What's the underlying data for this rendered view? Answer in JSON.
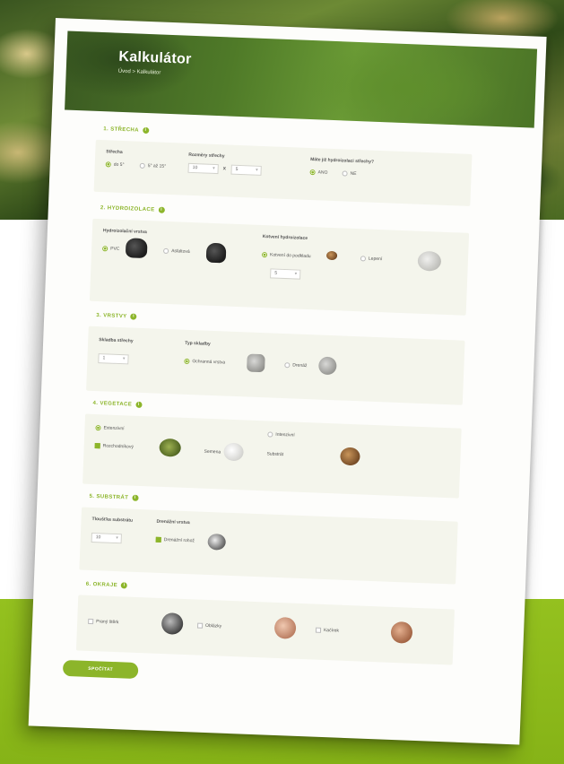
{
  "header": {
    "title": "Kalkulátor",
    "breadcrumb": "Úvod > Kalkulátor"
  },
  "sections": [
    {
      "title": "1. STŘECHA",
      "fields": {
        "roof_type_label": "Střecha",
        "roof_type_options": [
          "do 5°",
          "5° až 15°"
        ],
        "size_label": "Rozměry střechy",
        "size_a": "10",
        "size_b": "5",
        "size_sep": "x",
        "question_label": "Máte již hydroizolaci střechy?",
        "question_options": [
          "ANO",
          "NE"
        ]
      }
    },
    {
      "title": "2. HYDROIZOLACE",
      "fields": {
        "type_label": "Hydroizolační vrstva",
        "type_options": [
          "PVC",
          "Asfaltová"
        ],
        "extra_label": "Kotvení hydroizolace",
        "extra_options": [
          "Kotvení do podkladu",
          "Lepení"
        ],
        "extra_qty": "5"
      }
    },
    {
      "title": "3. VRSTVY",
      "fields": {
        "count_label": "Skladba střechy",
        "count_value": "1",
        "layer_label": "Typ skladby",
        "layer_options": [
          "Ochranná vrstva",
          "Drenáž"
        ]
      }
    },
    {
      "title": "4. VEGETACE",
      "fields": {
        "main_option": "Extenzivní",
        "mix_option": "Rozchodníkový",
        "mix_sub": "Semena",
        "right_option": "Intenzivní",
        "right_sub": "Substrát"
      }
    },
    {
      "title": "5. SUBSTRÁT",
      "fields": {
        "thickness_label": "Tloušťka substrátu",
        "thickness_value": "10",
        "drain_label": "Drenážní vrstva",
        "drain_option": "Drenážní rohož"
      }
    },
    {
      "title": "6. OKRAJE",
      "fields": {
        "options": [
          "Praný štěrk",
          "Oblázky",
          "Kačírek"
        ]
      }
    }
  ],
  "calc_button": "SPOČÍTAT"
}
